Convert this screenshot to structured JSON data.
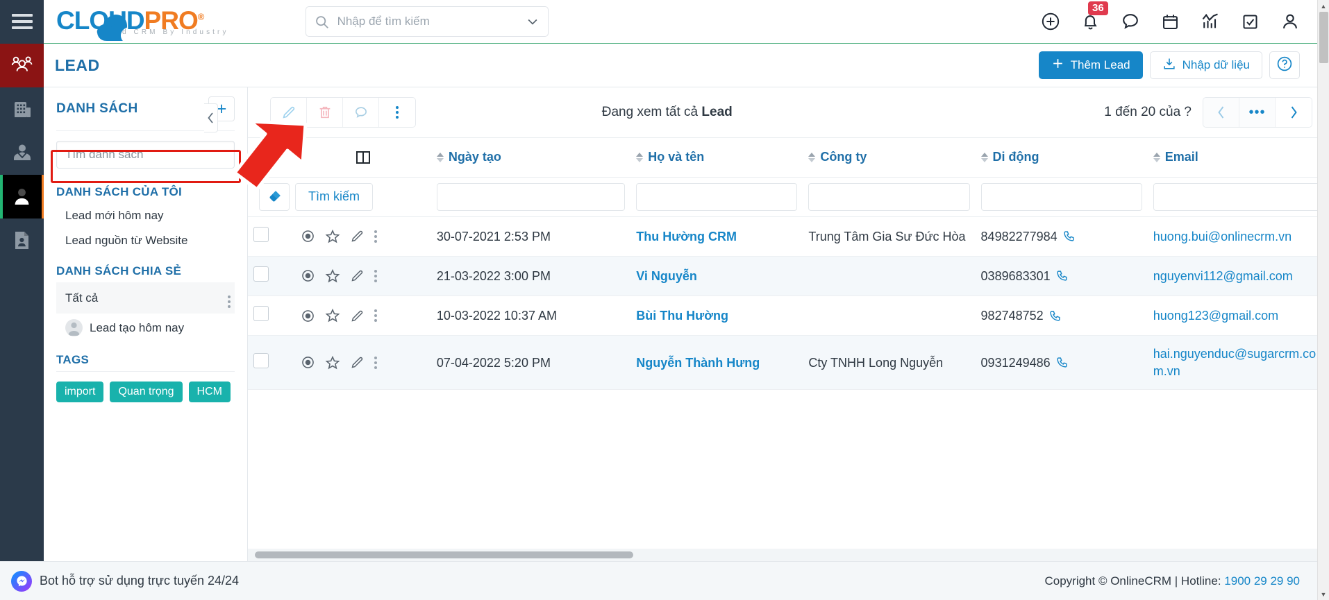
{
  "brand": {
    "name_part1": "CLOUD",
    "name_part2": "PRO",
    "registered": "®",
    "tagline": "Cloud CRM By Industry",
    "accent_blue": "#1686c8",
    "accent_orange": "#f07c22",
    "accent_green": "#4caf7d"
  },
  "topbar": {
    "search_placeholder": "Nhập để tìm kiếm",
    "search_value": "",
    "notification_count": "36",
    "icons": [
      "plus-circle-icon",
      "bell-icon",
      "chat-icon",
      "calendar-icon",
      "analytics-icon",
      "task-icon",
      "user-icon"
    ]
  },
  "page_header": {
    "title": "LEAD",
    "add_lead_label": "Thêm Lead",
    "import_label": "Nhập dữ liệu",
    "help_label": "?"
  },
  "list_panel": {
    "title": "DANH SÁCH",
    "add_button_label": "+",
    "search_placeholder": "Tìm danh sách",
    "search_value": "",
    "my_lists_title": "DANH SÁCH CỦA TÔI",
    "my_lists": [
      {
        "label": "Lead mới hôm nay"
      },
      {
        "label": "Lead nguồn từ Website"
      }
    ],
    "shared_lists_title": "DANH SÁCH CHIA SẺ",
    "shared_all_label": "Tất cả",
    "shared_lists": [
      {
        "label": "Lead tạo hôm nay"
      }
    ],
    "tags_title": "TAGS",
    "tags": [
      {
        "label": "import"
      },
      {
        "label": "Quan trọng"
      },
      {
        "label": "HCM"
      }
    ],
    "tag_color": "#19b2ac"
  },
  "toolbar": {
    "edit_label": "edit-icon",
    "delete_label": "delete-icon",
    "comment_label": "comment-icon",
    "more_label": "more-icon",
    "viewing_prefix": "Đang xem tất cả ",
    "viewing_entity": "Lead",
    "pager_label": "1 đến 20 của ?",
    "prev_label": "‹",
    "more_pages_label": "•••",
    "next_label": "›"
  },
  "table": {
    "columns": [
      {
        "key": "date",
        "label": "Ngày tạo",
        "sortable": true
      },
      {
        "key": "name",
        "label": "Họ và tên",
        "sortable": true
      },
      {
        "key": "comp",
        "label": "Công ty",
        "sortable": true
      },
      {
        "key": "mob",
        "label": "Di động",
        "sortable": true
      },
      {
        "key": "mail",
        "label": "Email",
        "sortable": true
      }
    ],
    "filter": {
      "erase_label": "eraser-icon",
      "search_label": "Tìm kiếm",
      "date_value": "",
      "name_value": "",
      "comp_value": "",
      "mob_value": "",
      "mail_value": ""
    },
    "rows": [
      {
        "date": "30-07-2021 2:53 PM",
        "name": "Thu Hường CRM",
        "company": "Trung Tâm Gia Sư Đức Hòa",
        "mobile": "84982277984",
        "email": "huong.bui@onlinecrm.vn"
      },
      {
        "date": "21-03-2022 3:00 PM",
        "name": "Vi Nguyễn",
        "company": "",
        "mobile": "0389683301",
        "email": "nguyenvi112@gmail.com"
      },
      {
        "date": "10-03-2022 10:37 AM",
        "name": "Bùi Thu Hường",
        "company": "",
        "mobile": "982748752",
        "email": "huong123@gmail.com"
      },
      {
        "date": "07-04-2022 5:20 PM",
        "name": "Nguyễn Thành Hưng",
        "company": "Cty TNHH Long Nguyễn",
        "mobile": "0931249486",
        "email": "hai.nguyenduc@sugarcrm.com.vn"
      }
    ]
  },
  "footer": {
    "bot_label": "Bot hỗ trợ sử dụng trực tuyến 24/24",
    "copyright": "Copyright © OnlineCRM | Hotline: ",
    "hotline": "1900 29 29 90"
  }
}
